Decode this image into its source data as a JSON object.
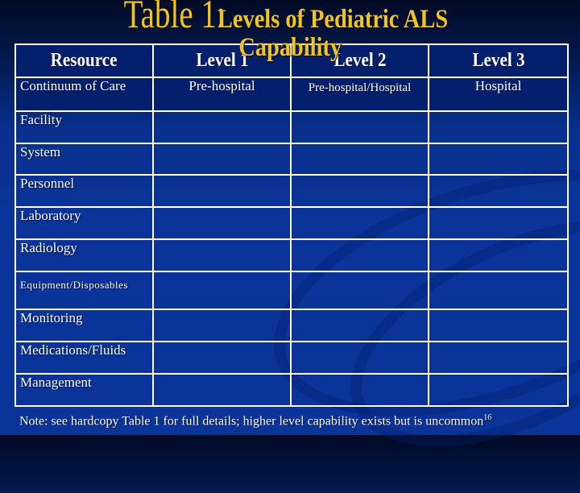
{
  "slide": {
    "title_prefix": "Table 1:",
    "title_main": "Levels of Pediatric ALS",
    "title_wrap": "Capability",
    "colors": {
      "title": "#f3c41c",
      "background": "#0a3499",
      "grid_lines": "#ffffff",
      "text": "#ffffff"
    }
  },
  "table": {
    "headers": [
      "Resource",
      "Level 1",
      "Level 2",
      "Level 3"
    ],
    "continuum_row": {
      "label": "Continuum of Care",
      "values": [
        "Pre-hospital",
        "Pre-hospital/Hospital",
        "Hospital"
      ]
    },
    "resource_rows": [
      "Facility",
      "System",
      "Personnel",
      "Laboratory",
      "Radiology",
      "Equipment/Disposables",
      "Monitoring",
      "Medications/Fluids",
      "Management"
    ]
  },
  "note": {
    "text": "Note:  see hardcopy Table 1 for full details; higher level capability exists but is uncommon",
    "superscript": "16"
  }
}
